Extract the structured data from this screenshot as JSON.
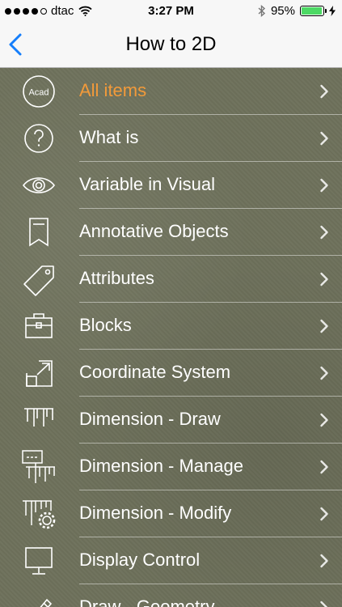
{
  "status": {
    "carrier": "dtac",
    "time": "3:27 PM",
    "battery_text": "95%",
    "battery_level": 0.95
  },
  "nav": {
    "title": "How to 2D"
  },
  "items": [
    {
      "label": "All items",
      "icon": "acad-logo-icon",
      "icon_text": "Acad",
      "active": true
    },
    {
      "label": "What is",
      "icon": "question-icon"
    },
    {
      "label": "Variable in Visual",
      "icon": "eye-icon"
    },
    {
      "label": "Annotative Objects",
      "icon": "bookmark-icon"
    },
    {
      "label": "Attributes",
      "icon": "tag-icon"
    },
    {
      "label": "Blocks",
      "icon": "briefcase-icon"
    },
    {
      "label": "Coordinate System",
      "icon": "expand-arrow-icon"
    },
    {
      "label": "Dimension - Draw",
      "icon": "dimension-draw-icon"
    },
    {
      "label": "Dimension - Manage",
      "icon": "dimension-manage-icon"
    },
    {
      "label": "Dimension - Modify",
      "icon": "dimension-modify-icon"
    },
    {
      "label": "Display Control",
      "icon": "monitor-icon"
    },
    {
      "label": "Draw - Geometry",
      "icon": "pencil-icon"
    }
  ],
  "colors": {
    "active_label": "#f29a3a",
    "accent_blue": "#157efb"
  }
}
